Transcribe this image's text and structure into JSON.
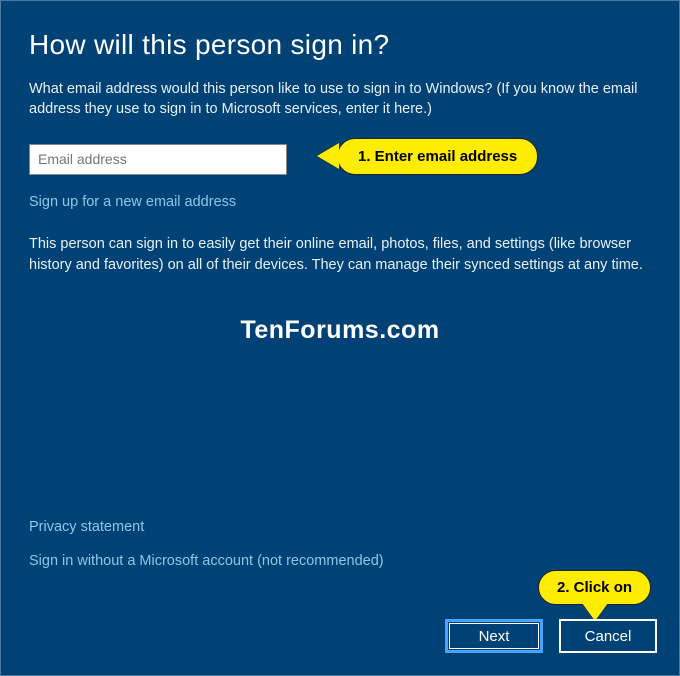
{
  "title": "How will this person sign in?",
  "description": "What email address would this person like to use to sign in to Windows? (If you know the email address they use to sign in to Microsoft services, enter it here.)",
  "email": {
    "placeholder": "Email address",
    "value": ""
  },
  "signup_link": "Sign up for a new email address",
  "info_text": "This person can sign in to easily get their online email, photos, files, and settings (like browser history and favorites) on all of their devices. They can manage their synced settings at any time.",
  "watermark": "TenForums.com",
  "privacy_link": "Privacy statement",
  "no_ms_link": "Sign in without a Microsoft account (not recommended)",
  "buttons": {
    "next": "Next",
    "cancel": "Cancel"
  },
  "annotations": {
    "step1": "1. Enter email address",
    "step2": "2. Click on"
  }
}
